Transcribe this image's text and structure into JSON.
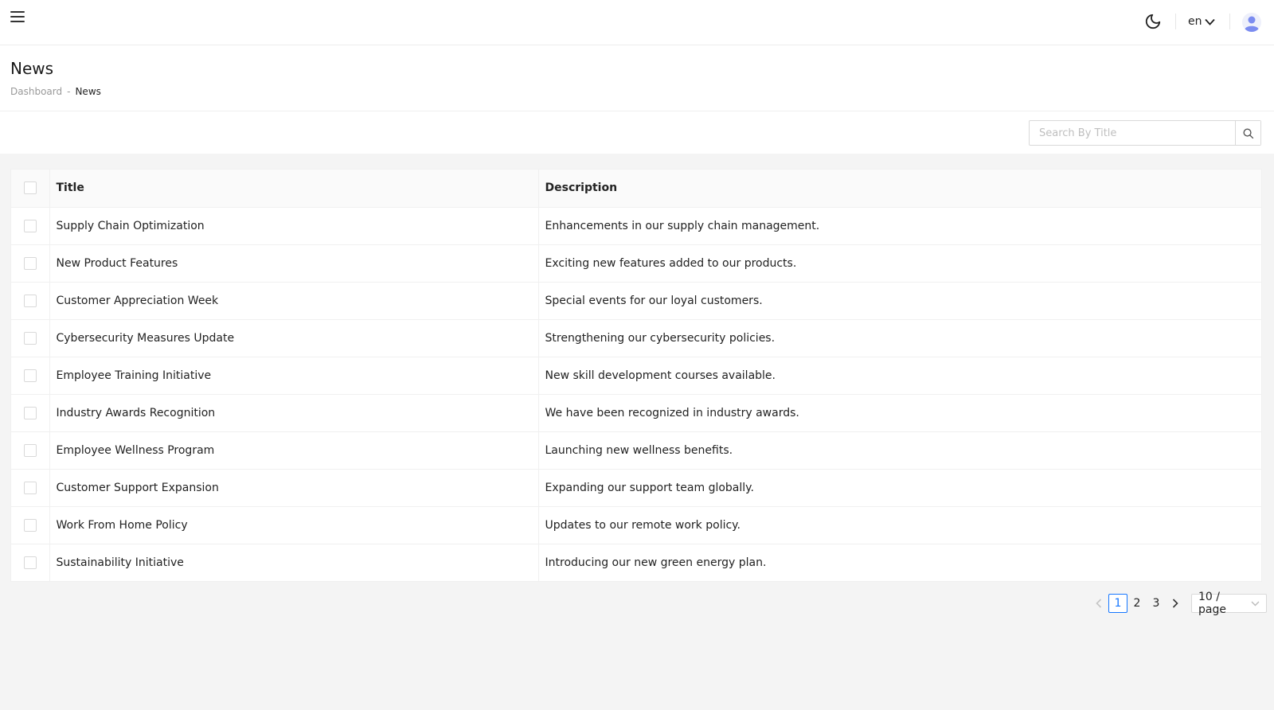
{
  "topbar": {
    "lang_label": "en"
  },
  "header": {
    "title": "News",
    "breadcrumb": {
      "parent": "Dashboard",
      "separator": "-",
      "current": "News"
    }
  },
  "search": {
    "placeholder": "Search By Title",
    "value": ""
  },
  "table": {
    "columns": [
      "Title",
      "Description"
    ],
    "rows": [
      {
        "title": "Supply Chain Optimization",
        "description": "Enhancements in our supply chain management."
      },
      {
        "title": "New Product Features",
        "description": "Exciting new features added to our products."
      },
      {
        "title": "Customer Appreciation Week",
        "description": "Special events for our loyal customers."
      },
      {
        "title": "Cybersecurity Measures Update",
        "description": "Strengthening our cybersecurity policies."
      },
      {
        "title": "Employee Training Initiative",
        "description": "New skill development courses available."
      },
      {
        "title": "Industry Awards Recognition",
        "description": "We have been recognized in industry awards."
      },
      {
        "title": "Employee Wellness Program",
        "description": "Launching new wellness benefits."
      },
      {
        "title": "Customer Support Expansion",
        "description": "Expanding our support team globally."
      },
      {
        "title": "Work From Home Policy",
        "description": "Updates to our remote work policy."
      },
      {
        "title": "Sustainability Initiative",
        "description": "Introducing our new green energy plan."
      }
    ]
  },
  "pagination": {
    "pages": [
      "1",
      "2",
      "3"
    ],
    "current": "1",
    "page_size": "10 / page"
  },
  "colors": {
    "accent": "#1677ff",
    "background": "#f4f4f4",
    "avatar": "#7b8cf0"
  }
}
